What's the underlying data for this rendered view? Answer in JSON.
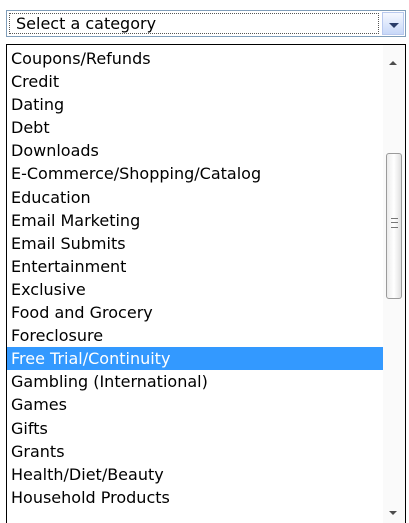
{
  "select": {
    "value": "Select a category"
  },
  "options": [
    "Coupons/Refunds",
    "Credit",
    "Dating",
    "Debt",
    "Downloads",
    "E-Commerce/Shopping/Catalog",
    "Education",
    "Email Marketing",
    "Email Submits",
    "Entertainment",
    "Exclusive",
    "Food and Grocery",
    "Foreclosure",
    "Free Trial/Continuity",
    "Gambling (International)",
    "Games",
    "Gifts",
    "Grants",
    "Health/Diet/Beauty",
    "Household Products"
  ],
  "highlighted": "Free Trial/Continuity",
  "colors": {
    "highlight_bg": "#3399ff",
    "highlight_text": "#ffffff",
    "border": "#7f9db9"
  }
}
